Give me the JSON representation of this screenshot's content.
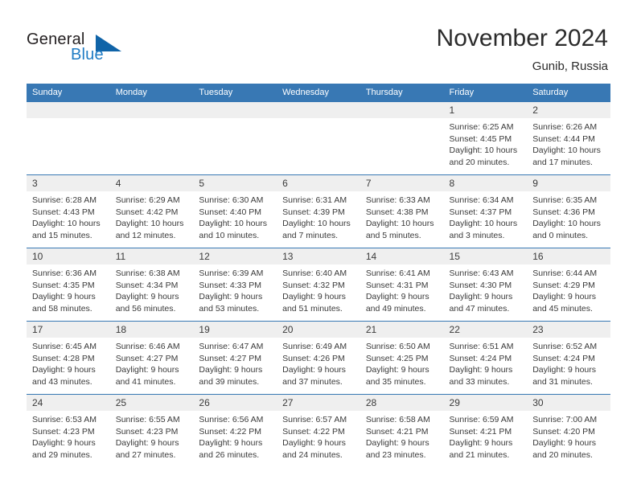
{
  "brand": {
    "name_part1": "General",
    "name_part2": "Blue",
    "accent_color": "#1064a8",
    "text_color": "#231f20"
  },
  "header": {
    "title": "November 2024",
    "subtitle": "Gunib, Russia"
  },
  "theme": {
    "header_bg": "#3878b4",
    "daynum_bg": "#efefef",
    "row_divider": "#3878b4",
    "text": "#3a3a3a"
  },
  "weekdays": [
    "Sunday",
    "Monday",
    "Tuesday",
    "Wednesday",
    "Thursday",
    "Friday",
    "Saturday"
  ],
  "weeks": [
    [
      {
        "day": "",
        "sunrise": "",
        "sunset": "",
        "daylight1": "",
        "daylight2": ""
      },
      {
        "day": "",
        "sunrise": "",
        "sunset": "",
        "daylight1": "",
        "daylight2": ""
      },
      {
        "day": "",
        "sunrise": "",
        "sunset": "",
        "daylight1": "",
        "daylight2": ""
      },
      {
        "day": "",
        "sunrise": "",
        "sunset": "",
        "daylight1": "",
        "daylight2": ""
      },
      {
        "day": "",
        "sunrise": "",
        "sunset": "",
        "daylight1": "",
        "daylight2": ""
      },
      {
        "day": "1",
        "sunrise": "Sunrise: 6:25 AM",
        "sunset": "Sunset: 4:45 PM",
        "daylight1": "Daylight: 10 hours",
        "daylight2": "and 20 minutes."
      },
      {
        "day": "2",
        "sunrise": "Sunrise: 6:26 AM",
        "sunset": "Sunset: 4:44 PM",
        "daylight1": "Daylight: 10 hours",
        "daylight2": "and 17 minutes."
      }
    ],
    [
      {
        "day": "3",
        "sunrise": "Sunrise: 6:28 AM",
        "sunset": "Sunset: 4:43 PM",
        "daylight1": "Daylight: 10 hours",
        "daylight2": "and 15 minutes."
      },
      {
        "day": "4",
        "sunrise": "Sunrise: 6:29 AM",
        "sunset": "Sunset: 4:42 PM",
        "daylight1": "Daylight: 10 hours",
        "daylight2": "and 12 minutes."
      },
      {
        "day": "5",
        "sunrise": "Sunrise: 6:30 AM",
        "sunset": "Sunset: 4:40 PM",
        "daylight1": "Daylight: 10 hours",
        "daylight2": "and 10 minutes."
      },
      {
        "day": "6",
        "sunrise": "Sunrise: 6:31 AM",
        "sunset": "Sunset: 4:39 PM",
        "daylight1": "Daylight: 10 hours",
        "daylight2": "and 7 minutes."
      },
      {
        "day": "7",
        "sunrise": "Sunrise: 6:33 AM",
        "sunset": "Sunset: 4:38 PM",
        "daylight1": "Daylight: 10 hours",
        "daylight2": "and 5 minutes."
      },
      {
        "day": "8",
        "sunrise": "Sunrise: 6:34 AM",
        "sunset": "Sunset: 4:37 PM",
        "daylight1": "Daylight: 10 hours",
        "daylight2": "and 3 minutes."
      },
      {
        "day": "9",
        "sunrise": "Sunrise: 6:35 AM",
        "sunset": "Sunset: 4:36 PM",
        "daylight1": "Daylight: 10 hours",
        "daylight2": "and 0 minutes."
      }
    ],
    [
      {
        "day": "10",
        "sunrise": "Sunrise: 6:36 AM",
        "sunset": "Sunset: 4:35 PM",
        "daylight1": "Daylight: 9 hours",
        "daylight2": "and 58 minutes."
      },
      {
        "day": "11",
        "sunrise": "Sunrise: 6:38 AM",
        "sunset": "Sunset: 4:34 PM",
        "daylight1": "Daylight: 9 hours",
        "daylight2": "and 56 minutes."
      },
      {
        "day": "12",
        "sunrise": "Sunrise: 6:39 AM",
        "sunset": "Sunset: 4:33 PM",
        "daylight1": "Daylight: 9 hours",
        "daylight2": "and 53 minutes."
      },
      {
        "day": "13",
        "sunrise": "Sunrise: 6:40 AM",
        "sunset": "Sunset: 4:32 PM",
        "daylight1": "Daylight: 9 hours",
        "daylight2": "and 51 minutes."
      },
      {
        "day": "14",
        "sunrise": "Sunrise: 6:41 AM",
        "sunset": "Sunset: 4:31 PM",
        "daylight1": "Daylight: 9 hours",
        "daylight2": "and 49 minutes."
      },
      {
        "day": "15",
        "sunrise": "Sunrise: 6:43 AM",
        "sunset": "Sunset: 4:30 PM",
        "daylight1": "Daylight: 9 hours",
        "daylight2": "and 47 minutes."
      },
      {
        "day": "16",
        "sunrise": "Sunrise: 6:44 AM",
        "sunset": "Sunset: 4:29 PM",
        "daylight1": "Daylight: 9 hours",
        "daylight2": "and 45 minutes."
      }
    ],
    [
      {
        "day": "17",
        "sunrise": "Sunrise: 6:45 AM",
        "sunset": "Sunset: 4:28 PM",
        "daylight1": "Daylight: 9 hours",
        "daylight2": "and 43 minutes."
      },
      {
        "day": "18",
        "sunrise": "Sunrise: 6:46 AM",
        "sunset": "Sunset: 4:27 PM",
        "daylight1": "Daylight: 9 hours",
        "daylight2": "and 41 minutes."
      },
      {
        "day": "19",
        "sunrise": "Sunrise: 6:47 AM",
        "sunset": "Sunset: 4:27 PM",
        "daylight1": "Daylight: 9 hours",
        "daylight2": "and 39 minutes."
      },
      {
        "day": "20",
        "sunrise": "Sunrise: 6:49 AM",
        "sunset": "Sunset: 4:26 PM",
        "daylight1": "Daylight: 9 hours",
        "daylight2": "and 37 minutes."
      },
      {
        "day": "21",
        "sunrise": "Sunrise: 6:50 AM",
        "sunset": "Sunset: 4:25 PM",
        "daylight1": "Daylight: 9 hours",
        "daylight2": "and 35 minutes."
      },
      {
        "day": "22",
        "sunrise": "Sunrise: 6:51 AM",
        "sunset": "Sunset: 4:24 PM",
        "daylight1": "Daylight: 9 hours",
        "daylight2": "and 33 minutes."
      },
      {
        "day": "23",
        "sunrise": "Sunrise: 6:52 AM",
        "sunset": "Sunset: 4:24 PM",
        "daylight1": "Daylight: 9 hours",
        "daylight2": "and 31 minutes."
      }
    ],
    [
      {
        "day": "24",
        "sunrise": "Sunrise: 6:53 AM",
        "sunset": "Sunset: 4:23 PM",
        "daylight1": "Daylight: 9 hours",
        "daylight2": "and 29 minutes."
      },
      {
        "day": "25",
        "sunrise": "Sunrise: 6:55 AM",
        "sunset": "Sunset: 4:23 PM",
        "daylight1": "Daylight: 9 hours",
        "daylight2": "and 27 minutes."
      },
      {
        "day": "26",
        "sunrise": "Sunrise: 6:56 AM",
        "sunset": "Sunset: 4:22 PM",
        "daylight1": "Daylight: 9 hours",
        "daylight2": "and 26 minutes."
      },
      {
        "day": "27",
        "sunrise": "Sunrise: 6:57 AM",
        "sunset": "Sunset: 4:22 PM",
        "daylight1": "Daylight: 9 hours",
        "daylight2": "and 24 minutes."
      },
      {
        "day": "28",
        "sunrise": "Sunrise: 6:58 AM",
        "sunset": "Sunset: 4:21 PM",
        "daylight1": "Daylight: 9 hours",
        "daylight2": "and 23 minutes."
      },
      {
        "day": "29",
        "sunrise": "Sunrise: 6:59 AM",
        "sunset": "Sunset: 4:21 PM",
        "daylight1": "Daylight: 9 hours",
        "daylight2": "and 21 minutes."
      },
      {
        "day": "30",
        "sunrise": "Sunrise: 7:00 AM",
        "sunset": "Sunset: 4:20 PM",
        "daylight1": "Daylight: 9 hours",
        "daylight2": "and 20 minutes."
      }
    ]
  ]
}
